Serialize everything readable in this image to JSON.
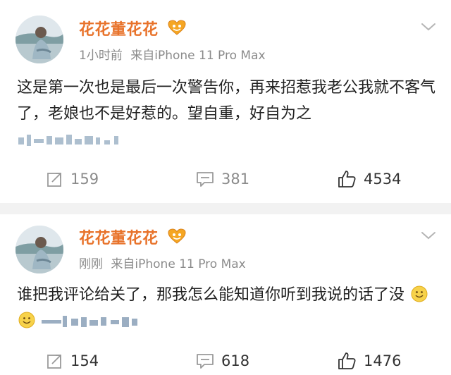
{
  "posts": [
    {
      "username": "花花董花花",
      "time": "1小时前",
      "source": "来自iPhone 11 Pro Max",
      "text": "这是第一次也是最后一次警告你，再来招惹我老公我就不客气了，老娘也不是好惹的。望自重，好自为之",
      "actions": {
        "repost": "159",
        "comment": "381",
        "like": "4534"
      }
    },
    {
      "username": "花花董花花",
      "time": "刚刚",
      "source": "来自iPhone 11 Pro Max",
      "text": "谁把我评论给关了，那我怎么能知道你听到我说的话了没",
      "actions": {
        "repost": "154",
        "comment": "618",
        "like": "1476"
      }
    }
  ],
  "icons": [
    "avatar",
    "vip-badge-icon",
    "chevron-down-icon",
    "repost-icon",
    "comment-icon",
    "like-icon",
    "smiley-icon"
  ],
  "colors": {
    "username": "#e8732b",
    "meta": "#8b8b8b",
    "divider": "#f2f2f2"
  }
}
